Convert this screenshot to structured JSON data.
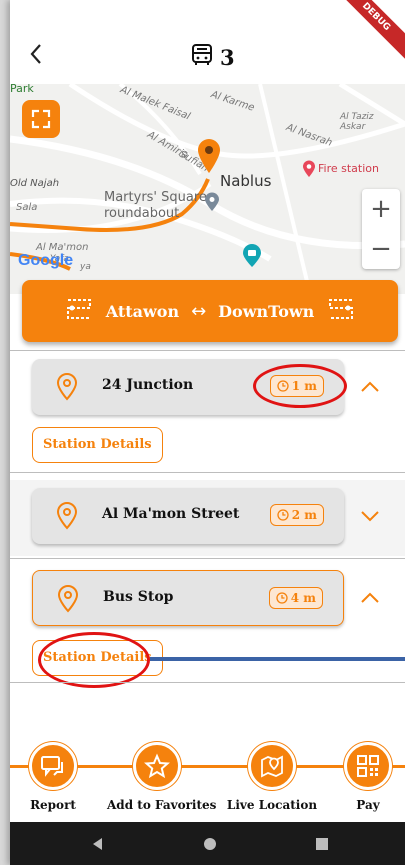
{
  "header": {
    "back_icon": "back-arrow-icon",
    "bus_icon": "bus-icon",
    "title": "3",
    "debug_banner": "DEBUG"
  },
  "map": {
    "labels": {
      "park": "Park",
      "al_malek_faisal": "Al Malek Faisal",
      "al_karme": "Al Karme",
      "al_amiria": "Al Amiria",
      "sufian": "Sufian",
      "al_taziz_askar": "Al Taziz Askar",
      "al_nasrah": "Al Nasrah",
      "fire_station": "Fire station",
      "nablus": "Nablus",
      "old_najah": "Old Najah",
      "sala": "Sala",
      "martyrs_square": "Martyrs' Square",
      "roundabout": "roundabout",
      "al_mamon": "Al Ma'mon",
      "yafa": "Yafa",
      "google": "Google",
      "ya": "ya"
    },
    "zoom_in": "+",
    "zoom_out": "−",
    "accent_color": "#f5820d"
  },
  "route": {
    "from": "Attawon",
    "arrow": "↔",
    "to": "DownTown"
  },
  "stops": [
    {
      "name": "24 Junction",
      "time": "1 m",
      "expanded": true,
      "details_label": "Station Details"
    },
    {
      "name": "Al Ma'mon Street",
      "time": "2 m",
      "expanded": false
    },
    {
      "name": "Bus Stop",
      "time": "4 m",
      "expanded": true,
      "details_label": "Station Details"
    }
  ],
  "actions": [
    {
      "label": "Report",
      "icon": "chat-icon"
    },
    {
      "label": "Add to Favorites",
      "icon": "star-icon"
    },
    {
      "label": "Live Location",
      "icon": "map-pin-icon"
    },
    {
      "label": "Pay",
      "icon": "qr-code-icon"
    }
  ],
  "colors": {
    "accent": "#f5820d",
    "annotation_red": "#e01313",
    "card_bg": "#e4e4e4",
    "highlight_line": "#3b63a6"
  }
}
